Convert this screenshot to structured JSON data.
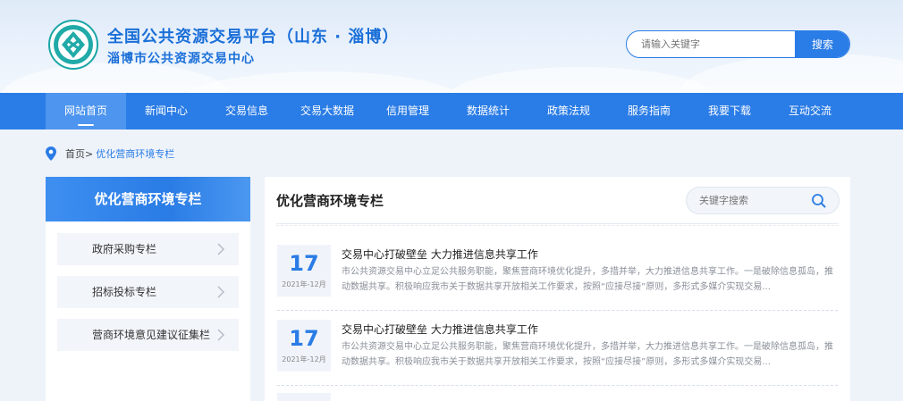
{
  "header": {
    "title": "全国公共资源交易平台（山东 · 淄博）",
    "subtitle": "淄博市公共资源交易中心",
    "search_placeholder": "请输入关键字",
    "search_button": "搜索"
  },
  "nav": {
    "items": [
      {
        "label": "网站首页",
        "active": true
      },
      {
        "label": "新闻中心"
      },
      {
        "label": "交易信息"
      },
      {
        "label": "交易大数据"
      },
      {
        "label": "信用管理"
      },
      {
        "label": "数据统计"
      },
      {
        "label": "政策法规"
      },
      {
        "label": "服务指南"
      },
      {
        "label": "我要下载"
      },
      {
        "label": "互动交流"
      }
    ]
  },
  "breadcrumb": {
    "home": "首页>",
    "current": "优化营商环境专栏"
  },
  "sidebar": {
    "title": "优化营商环境专栏",
    "items": [
      {
        "label": "政府采购专栏"
      },
      {
        "label": "招标投标专栏"
      },
      {
        "label": "营商环境意见建议征集栏"
      }
    ]
  },
  "content": {
    "title": "优化营商环境专栏",
    "keyword_placeholder": "关键字搜索",
    "news": [
      {
        "day": "17",
        "year_month": "2021年-12月",
        "title": "交易中心打破壁垒 大力推进信息共享工作",
        "summary": "市公共资源交易中心立足公共服务职能，聚焦营商环境优化提升，多措并举，大力推进信息共享工作。一是破除信息孤岛，推动数据共享。积极响应我市关于数据共享开放相关工作要求，按照“应接尽接”原则，多形式多媒介实现交易..."
      },
      {
        "day": "17",
        "year_month": "2021年-12月",
        "title": "交易中心打破壁垒 大力推进信息共享工作",
        "summary": "市公共资源交易中心立足公共服务职能，聚焦营商环境优化提升，多措并举，大力推进信息共享工作。一是破除信息孤岛，推动数据共享。积极响应我市关于数据共享开放相关工作要求，按照“应接尽接”原则，多形式多媒介实现交易..."
      }
    ]
  },
  "colors": {
    "primary": "#2a7ce6",
    "nav_active": "#4d95ee",
    "page_bg": "#eef3fa"
  },
  "icons": {
    "logo": "emblem-logo",
    "breadcrumb": "location-pin-icon",
    "sidebar_arrow": "chevron-right-icon",
    "keyword_search": "search-icon"
  }
}
